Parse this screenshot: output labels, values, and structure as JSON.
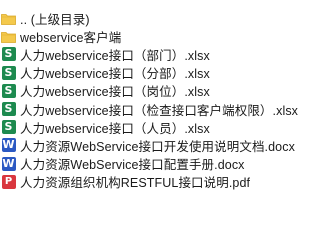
{
  "file_list": {
    "items": [
      {
        "name": ".. (上级目录)",
        "icon": "folder-icon",
        "color": "#f4c94c"
      },
      {
        "name": "webservice客户端",
        "icon": "folder-icon",
        "color": "#f4c94c"
      },
      {
        "name": "人力webservice接口（部门）.xlsx",
        "icon": "spreadsheet-icon",
        "glyph": "S",
        "color": "#1d8a4f"
      },
      {
        "name": "人力webservice接口（分部）.xlsx",
        "icon": "spreadsheet-icon",
        "glyph": "S",
        "color": "#1d8a4f"
      },
      {
        "name": "人力webservice接口（岗位）.xlsx",
        "icon": "spreadsheet-icon",
        "glyph": "S",
        "color": "#1d8a4f"
      },
      {
        "name": "人力webservice接口（检查接口客户端权限）.xlsx",
        "icon": "spreadsheet-icon",
        "glyph": "S",
        "color": "#1d8a4f"
      },
      {
        "name": "人力webservice接口（人员）.xlsx",
        "icon": "spreadsheet-icon",
        "glyph": "S",
        "color": "#1d8a4f"
      },
      {
        "name": "人力资源WebService接口开发使用说明文档.docx",
        "icon": "document-icon",
        "glyph": "W",
        "color": "#2b59c3"
      },
      {
        "name": "人力资源WebService接口配置手册.docx",
        "icon": "document-icon",
        "glyph": "W",
        "color": "#2b59c3"
      },
      {
        "name": "人力资源组织机构RESTFUL接口说明.pdf",
        "icon": "pdf-icon",
        "glyph": "P",
        "color": "#d9363e"
      }
    ]
  }
}
